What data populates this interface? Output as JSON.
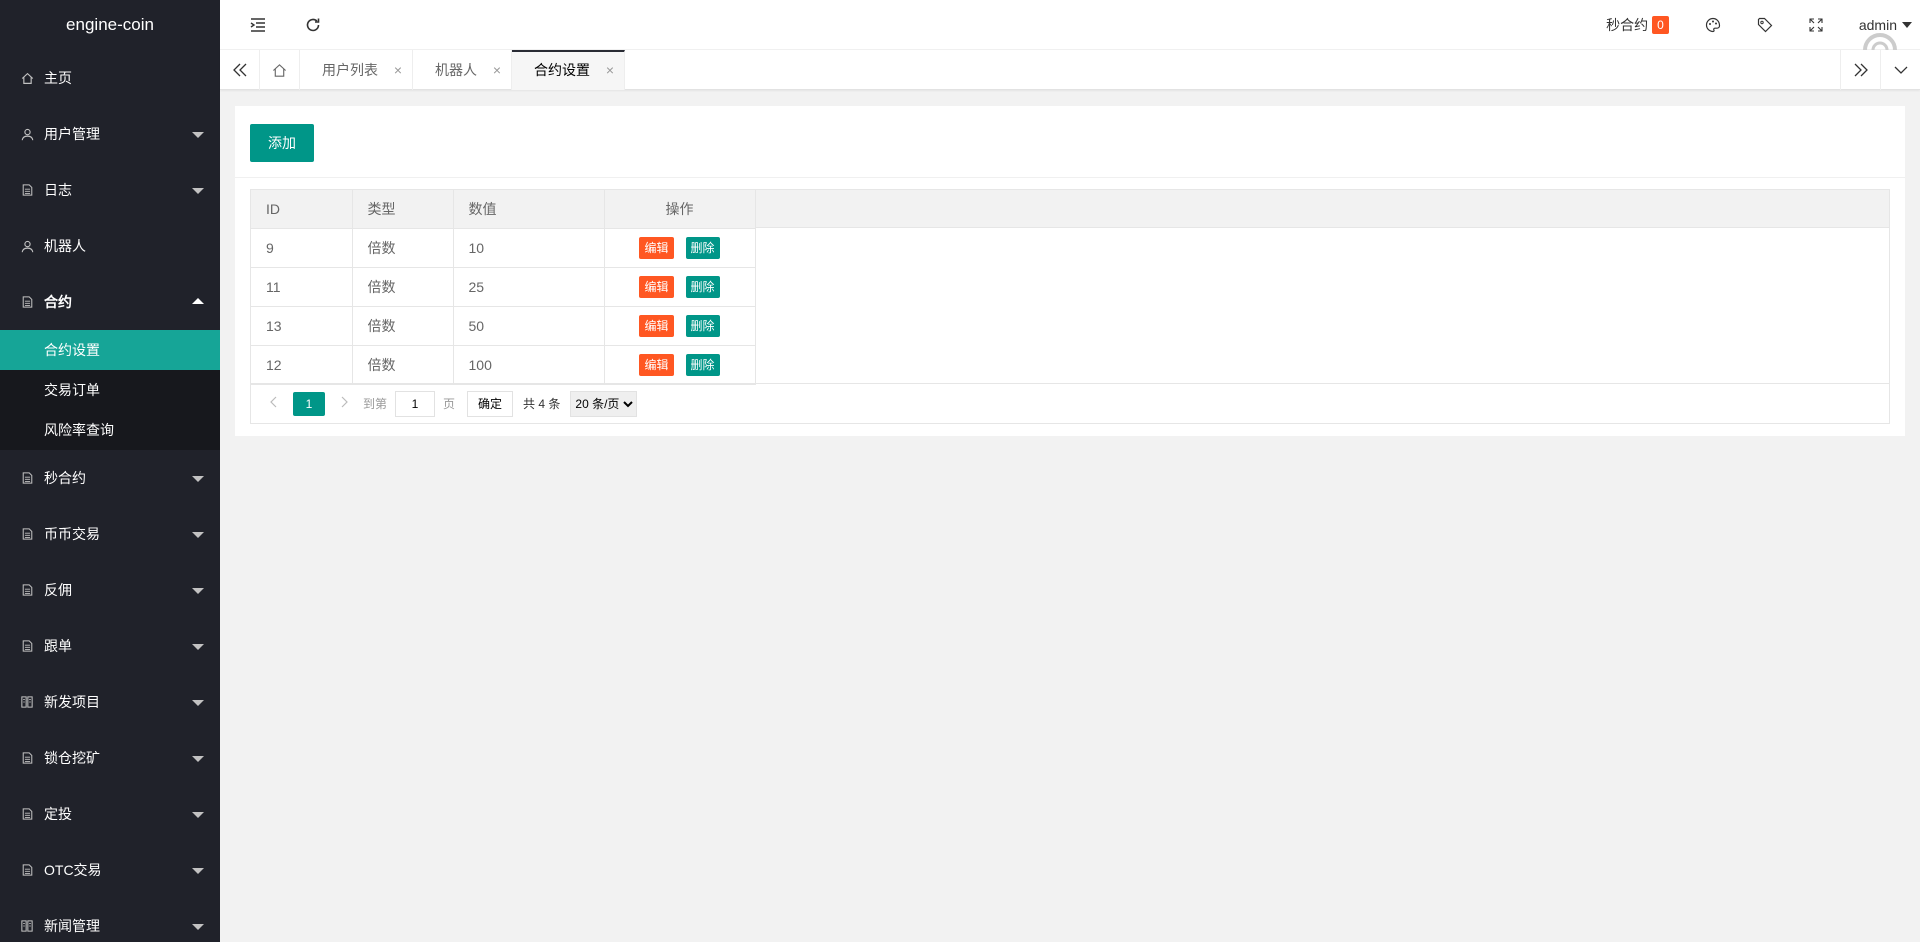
{
  "app": {
    "logo": "engine-coin"
  },
  "sidebar": {
    "items": [
      {
        "label": "主页",
        "icon": "home-icon",
        "expandable": false
      },
      {
        "label": "用户管理",
        "icon": "user-icon",
        "expandable": true
      },
      {
        "label": "日志",
        "icon": "doc-icon",
        "expandable": true
      },
      {
        "label": "机器人",
        "icon": "user-icon",
        "expandable": false
      },
      {
        "label": "合约",
        "icon": "doc-icon",
        "expandable": true,
        "open": true,
        "children": [
          {
            "label": "合约设置",
            "active": true
          },
          {
            "label": "交易订单"
          },
          {
            "label": "风险率查询"
          }
        ]
      },
      {
        "label": "秒合约",
        "icon": "doc-icon",
        "expandable": true
      },
      {
        "label": "币币交易",
        "icon": "doc-icon",
        "expandable": true
      },
      {
        "label": "反佣",
        "icon": "doc-icon",
        "expandable": true
      },
      {
        "label": "跟单",
        "icon": "doc-icon",
        "expandable": true
      },
      {
        "label": "新发项目",
        "icon": "news-icon",
        "expandable": true
      },
      {
        "label": "锁仓挖矿",
        "icon": "doc-icon",
        "expandable": true
      },
      {
        "label": "定投",
        "icon": "doc-icon",
        "expandable": true
      },
      {
        "label": "OTC交易",
        "icon": "doc-icon",
        "expandable": true
      },
      {
        "label": "新闻管理",
        "icon": "news-icon",
        "expandable": true
      }
    ]
  },
  "header": {
    "second_contract_label": "秒合约",
    "second_contract_count": "0",
    "user": "admin"
  },
  "tabs": [
    {
      "label": "用户列表",
      "active": false
    },
    {
      "label": "机器人",
      "active": false
    },
    {
      "label": "合约设置",
      "active": true
    }
  ],
  "toolbar": {
    "add_label": "添加"
  },
  "table": {
    "columns": [
      "ID",
      "类型",
      "数值",
      "操作"
    ],
    "rows": [
      {
        "id": "9",
        "type": "倍数",
        "value": "10"
      },
      {
        "id": "11",
        "type": "倍数",
        "value": "25"
      },
      {
        "id": "13",
        "type": "倍数",
        "value": "50"
      },
      {
        "id": "12",
        "type": "倍数",
        "value": "100"
      }
    ],
    "edit_label": "编辑",
    "delete_label": "删除"
  },
  "pager": {
    "current": "1",
    "goto_label": "到第",
    "goto_value": "1",
    "page_unit": "页",
    "confirm_label": "确定",
    "total_text": "共 4 条",
    "page_size": "20 条/页"
  },
  "colors": {
    "accent": "#009688",
    "danger": "#ff5722",
    "sidebar_bg": "#20222a",
    "active_item": "#16a597"
  }
}
